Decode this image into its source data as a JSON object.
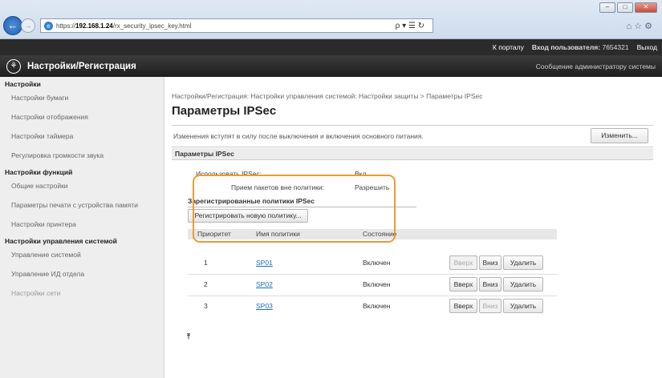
{
  "browser": {
    "url_prefix": "https://",
    "url_host": "192.168.1.24",
    "url_path": "/rx_security_ipsec_key.html",
    "addr_tools": "ρ ▾ ☰ ↻",
    "tool_icons": "⌂ ☆ ⚙",
    "win_minimize": "–",
    "win_maximize": "□",
    "win_close": "✕"
  },
  "topbar": {
    "portal_link": "К порталу",
    "user_label": "Вход пользователя:",
    "user_id": "7654321",
    "logout": "Выход"
  },
  "appbar": {
    "logo_glyph": "⚘",
    "title": "Настройки/Регистрация",
    "admin_msg": "Сообщение администратору системы"
  },
  "sidebar": {
    "section1": "Настройки",
    "items1": [
      "Настройки бумаги",
      "Настройки отображения",
      "Настройки таймера",
      "Регулировка громкости звука"
    ],
    "section2": "Настройки функций",
    "items2": [
      "Общие настройки",
      "Параметры печати с устройства памяти",
      "Настройки принтера"
    ],
    "section3": "Настройки управления системой",
    "items3": [
      "Управление системой",
      "Управление ИД отдела",
      "Настройки сети"
    ]
  },
  "main": {
    "breadcrumb": "Настройки/Регистрация: Настройки управления системой: Настройки защиты > Параметры IPSec",
    "title": "Параметры IPSec",
    "notice": "Изменения вступят в силу после выключения и включения основного питания.",
    "edit_button": "Изменить...",
    "section_header": "Параметры IPSec",
    "use_ipsec_label": "Использовать IPSec:",
    "use_ipsec_value": "Вкл.",
    "accept_label": "Прием пакетов вне политики:",
    "accept_value": "Разрешить",
    "registered_header": "Зарегистрированные политики IPSec",
    "register_button": "Регистрировать новую политику...",
    "columns": {
      "priority": "Приоритет",
      "name": "Имя политики",
      "state": "Состояние"
    },
    "rows": [
      {
        "priority": "1",
        "name": "SP01",
        "state": "Включен",
        "up": "Вверх",
        "down": "Вниз",
        "delete": "Удалить"
      },
      {
        "priority": "2",
        "name": "SP02",
        "state": "Включен",
        "up": "Вверх",
        "down": "Вниз",
        "delete": "Удалить"
      },
      {
        "priority": "3",
        "name": "SP03",
        "state": "Включен",
        "up": "Вверх",
        "down": "Вниз",
        "delete": "Удалить"
      }
    ],
    "to_top_glyph": "⤒",
    "highlight_color": "#ef9a33"
  }
}
